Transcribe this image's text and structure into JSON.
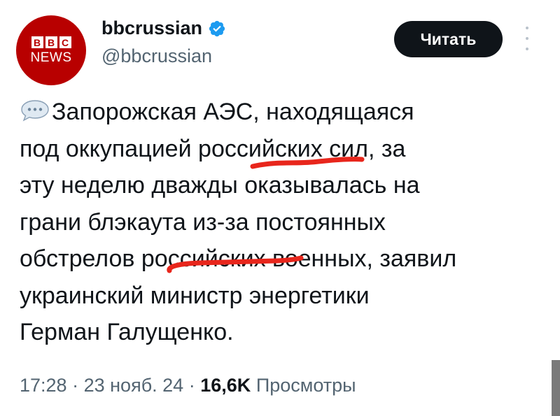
{
  "header": {
    "display_name": "bbcrussian",
    "handle": "@bbcrussian",
    "avatar": {
      "logo_letters": [
        "B",
        "B",
        "C"
      ],
      "logo_word": "NEWS",
      "brand_color": "#b80000"
    },
    "verified_icon": "verified-badge-icon",
    "verified_color": "#1d9bf0",
    "read_button_label": "Читать",
    "more_icon": "more-vertical-icon"
  },
  "tweet": {
    "emoji_icon": "speech-bubble-icon",
    "lines": [
      "Запорожская АЭС, находящаяся",
      "под оккупацией российских сил, за",
      "эту неделю дважды оказывалась на",
      "грани блэкаута из-за постоянных",
      "обстрелов российских военных, заявил",
      "украинский министр энергетики",
      "Герман Галущенко."
    ],
    "highlight_color": "#e8261c"
  },
  "meta": {
    "time": "17:28",
    "separator": "·",
    "date": "23 нояб. 24",
    "views_count": "16,6K",
    "views_label": "Просмотры"
  }
}
